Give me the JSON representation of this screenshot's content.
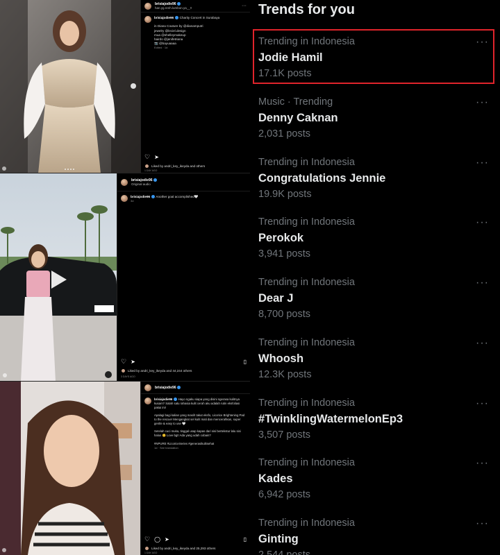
{
  "posts": [
    {
      "username": "brisiajodie96",
      "subtitle": "han.yg.renh.lumbon.ya__!!",
      "caption_user": "brisiajodie96",
      "caption": "Charity Concert in Surabaya",
      "caption_lines": [
        "in Diana Couture by @dianamputri",
        "jewelry @leciel.design",
        "mua @shelleymakeup",
        "hairdo @jenifetriana",
        "📷 @bayuaaaa"
      ],
      "meta": "Edited · 1d",
      "liked_by": "Liked by andri_key_ikeyda and others",
      "time": "1 DAY AGO"
    },
    {
      "username": "brisiajodie96",
      "subtitle": "Original audio",
      "caption_user": "brisiajodie96",
      "caption": "Another goal accomplished🤍",
      "meta": "3d",
      "liked_by": "Liked by andri_key_ikeyda and 44,244 others",
      "time": "3 DAYS AGO"
    },
    {
      "username": "brisiajodie96",
      "caption_user": "brisiajodie96",
      "caption": "Hayo ngaku siapa yang disini ngerasa kulitnya kusam? Salah satu rahasia kulit cerah aku adalah rutin eksfoliasi pakai ini!",
      "caption_lines": [
        "Apalagi bagi kalian yang masih takut eksfo, Licorice Brightening Pad to the rescue! Mengangkat sel kulit mati dan mencerahkan, super gentle & easy to use 🤍",
        "Setelah cuci muka, tinggal usap kapas dari sisi bertekstur lalu sisi halus 😊 Love bgt! Ada yang udah cobain?",
        "#NPURE #LicoriceSeries #generasikulitsehat"
      ],
      "meta": "1d · See translation",
      "liked_by": "Liked by andri_key_ikeyda and 25,293 others",
      "time": "1 DAY AGO"
    }
  ],
  "trends_title": "Trends for you",
  "trends": [
    {
      "context": "Trending in Indonesia",
      "name": "Jodie Hamil",
      "count": "17.1K posts"
    },
    {
      "context": "Music · Trending",
      "name": "Denny Caknan",
      "count": "2,031 posts"
    },
    {
      "context": "Trending in Indonesia",
      "name": "Congratulations Jennie",
      "count": "19.9K posts"
    },
    {
      "context": "Trending in Indonesia",
      "name": "Perokok",
      "count": "3,941 posts"
    },
    {
      "context": "Trending in Indonesia",
      "name": "Dear J",
      "count": "8,700 posts"
    },
    {
      "context": "Trending in Indonesia",
      "name": "Whoosh",
      "count": "12.3K posts"
    },
    {
      "context": "Trending in Indonesia",
      "name": "#TwinklingWatermelonEp3",
      "count": "3,507 posts"
    },
    {
      "context": "Trending in Indonesia",
      "name": "Kades",
      "count": "6,942 posts"
    },
    {
      "context": "Trending in Indonesia",
      "name": "Ginting",
      "count": "2,544 posts"
    }
  ],
  "more_label": "···",
  "highlight_color": "#e0242b",
  "accent": "#3897f0"
}
